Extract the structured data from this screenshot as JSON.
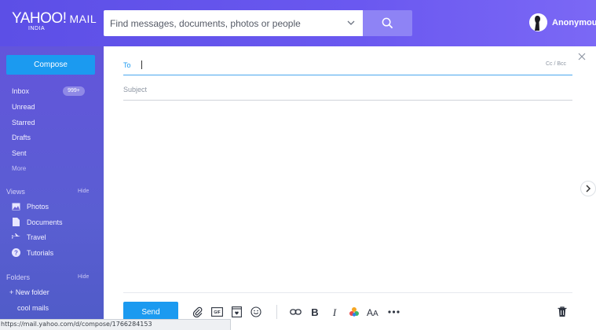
{
  "header": {
    "logo": {
      "brand": "YAHOO!",
      "product": "MAIL",
      "region": "INDIA"
    },
    "search": {
      "placeholder": "Find messages, documents, photos or people"
    },
    "user": {
      "name": "Anonymous"
    }
  },
  "sidebar": {
    "compose_label": "Compose",
    "folders": [
      {
        "label": "Inbox",
        "badge": "999+"
      },
      {
        "label": "Unread"
      },
      {
        "label": "Starred"
      },
      {
        "label": "Drafts"
      },
      {
        "label": "Sent"
      }
    ],
    "more_label": "More",
    "views": {
      "title": "Views",
      "hide_label": "Hide",
      "items": [
        {
          "label": "Photos",
          "icon": "photo-icon"
        },
        {
          "label": "Documents",
          "icon": "document-icon"
        },
        {
          "label": "Travel",
          "icon": "plane-icon"
        },
        {
          "label": "Tutorials",
          "icon": "help-icon"
        }
      ]
    },
    "folder_section": {
      "title": "Folders",
      "hide_label": "Hide",
      "new_folder_label": "+ New folder",
      "custom": [
        "cool mails"
      ]
    }
  },
  "compose": {
    "to_label": "To",
    "cc_bcc_label": "Cc / Bcc",
    "subject_placeholder": "Subject",
    "send_label": "Send"
  },
  "status_bar": {
    "url": "https://mail.yahoo.com/d/compose/1766284153"
  },
  "colors": {
    "accent": "#1b9af0",
    "header": "#6a58f0",
    "sidebar": "#5a5ed2"
  }
}
